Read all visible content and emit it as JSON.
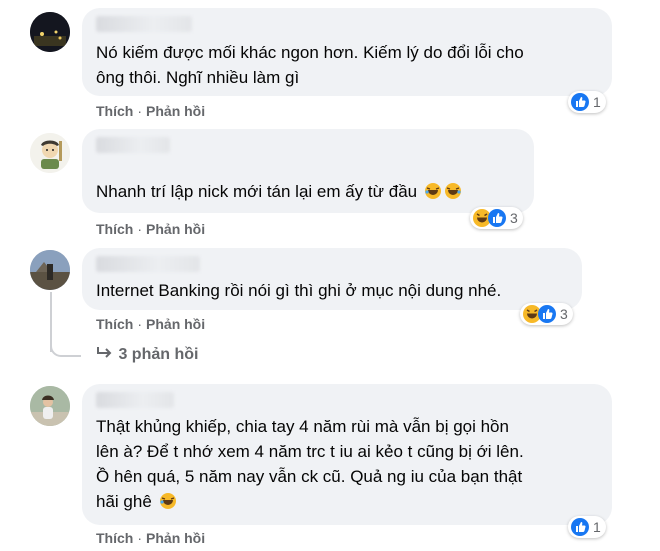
{
  "comments": [
    {
      "lines": [
        "Nó kiếm được mối khác ngon hơn. Kiếm lý do đổi lỗi cho",
        "ông thôi. Nghĩ nhiều làm gì"
      ],
      "like_label": "Thích",
      "reply_label": "Phản hồi",
      "separator": "·",
      "reaction_count": "1",
      "reactions": [
        "like-icon"
      ]
    },
    {
      "lines": [
        "Nhanh trí lập nick mới tán lại em ấy từ đầu"
      ],
      "inline_emoji": [
        "rofl-emoji",
        "rofl-emoji"
      ],
      "like_label": "Thích",
      "reply_label": "Phản hồi",
      "separator": "·",
      "reaction_count": "3",
      "reactions": [
        "haha-icon",
        "like-icon"
      ]
    },
    {
      "lines": [
        "Internet Banking rồi nói gì thì ghi ở mục nội dung nhé."
      ],
      "like_label": "Thích",
      "reply_label": "Phản hồi",
      "separator": "·",
      "reaction_count": "3",
      "reactions": [
        "haha-icon",
        "like-icon"
      ],
      "replies_label": "3 phản hồi"
    },
    {
      "lines": [
        "Thật khủng khiếp, chia tay 4 năm rùi mà vẫn bị gọi hồn",
        "lên à? Để t nhớ xem 4 năm trc t iu ai kẻo t cũng bị ới lên.",
        "Ồ hên quá, 5 năm nay vẫn ck cũ. Quả ng iu của bạn thật",
        "hãi ghê"
      ],
      "inline_emoji": [
        "rofl-emoji"
      ],
      "like_label": "Thích",
      "reply_label": "Phản hồi",
      "separator": "·",
      "reaction_count": "1",
      "reactions": [
        "like-icon"
      ]
    }
  ],
  "colors": {
    "bubble": "#f0f2f5",
    "like_blue": "#1877f2",
    "haha_yellow": "#f7b928",
    "meta_gray": "#65676b"
  }
}
